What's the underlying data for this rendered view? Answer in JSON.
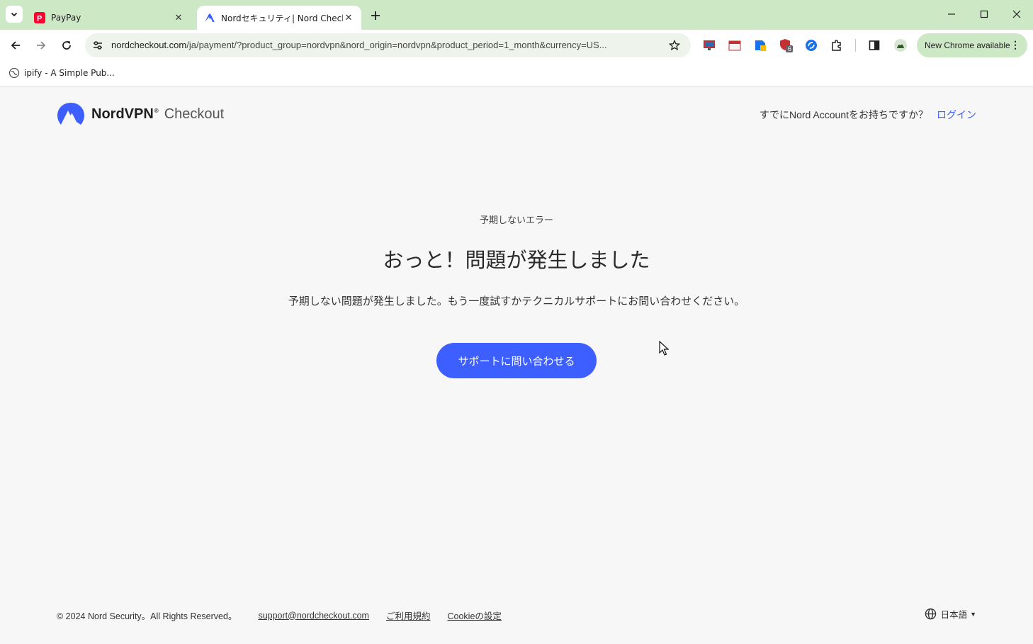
{
  "browser": {
    "tabs": [
      {
        "title": "PayPay",
        "active": false,
        "icon": "paypay-favicon"
      },
      {
        "title": "Nordセキュリティ| Nord Checkout",
        "active": true,
        "icon": "nordvpn-favicon"
      }
    ],
    "url_host": "nordcheckout.com",
    "url_rest": "/ja/payment/?product_group=nordvpn&nord_origin=nordvpn&product_period=1_month&currency=US...",
    "extension_badge": "6",
    "update_label": "New Chrome available",
    "bookmarks": [
      {
        "label": "ipify - A Simple Pub...",
        "icon": "globe-favicon"
      }
    ]
  },
  "header": {
    "brand": "NordVPN",
    "brand_suffix": "Checkout",
    "account_prompt": "すでにNord Accountをお持ちですか？",
    "login_label": "ログイン"
  },
  "error": {
    "kicker": "予期しないエラー",
    "title": "おっと！問題が発生しました",
    "description": "予期しない問題が発生しました。もう一度試すかテクニカルサポートにお問い合わせください。",
    "button_label": "サポートに問い合わせる"
  },
  "footer": {
    "copyright": "© 2024 Nord Security。All Rights Reserved。",
    "links": [
      "support@nordcheckout.com",
      "ご利用規約",
      "Cookieの設定"
    ],
    "language": "日本語"
  },
  "colors": {
    "accent": "#3e5fff",
    "tabbar": "#cce8c4",
    "page_bg": "#f7f7f7"
  }
}
